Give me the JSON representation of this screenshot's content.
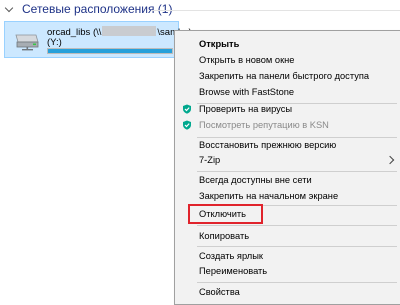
{
  "group": {
    "title": "Сетевые расположения (1)"
  },
  "drive": {
    "name_prefix": "orcad_libs (\\\\",
    "name_suffix": "\\samba)",
    "letter": "(Y:)",
    "usage_fraction": 1.0,
    "icon": "network-drive-icon"
  },
  "menu": {
    "open": "Открыть",
    "open_new_window": "Открыть в новом окне",
    "pin_quick_access": "Закрепить на панели быстрого доступа",
    "browse_faststone": "Browse with FastStone",
    "scan_viruses": "Проверить на вирусы",
    "check_reputation": "Посмотреть репутацию в KSN",
    "restore_previous": "Восстановить прежнюю версию",
    "seven_zip": "7-Zip",
    "always_offline": "Всегда доступны вне сети",
    "pin_start": "Закрепить на начальном экране",
    "disconnect": "Отключить",
    "copy": "Копировать",
    "create_shortcut": "Создать ярлык",
    "rename": "Переименовать",
    "properties": "Свойства"
  },
  "colors": {
    "kaspersky_green": "#00a88e",
    "highlight_red": "#e0232c",
    "selection_bg": "#cce8ff",
    "progress_fill": "#26a0da"
  }
}
